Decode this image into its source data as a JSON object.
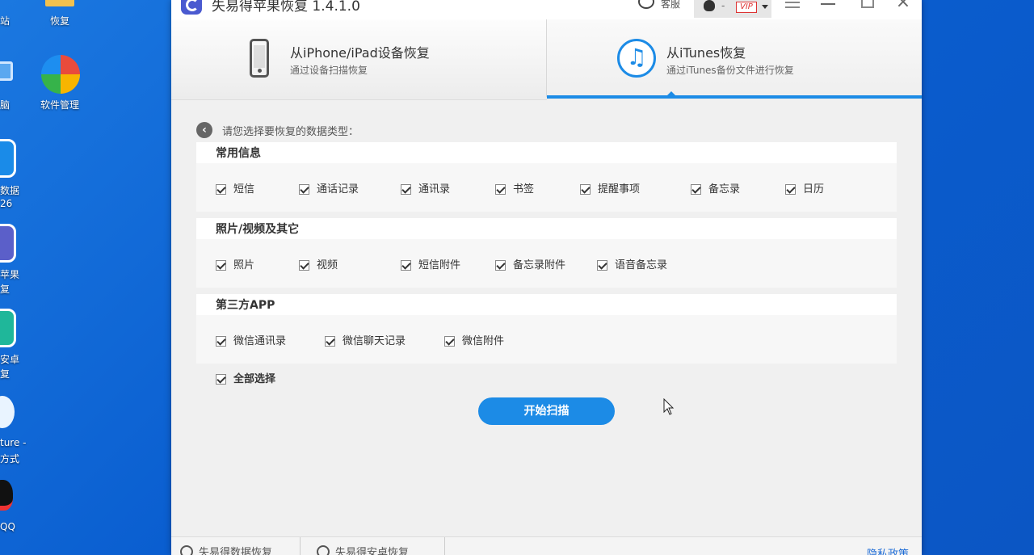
{
  "desktop": {
    "icons": [
      {
        "name": "desktop-icon-recovery-folder",
        "label": "恢复"
      },
      {
        "name": "desktop-icon-software-manager",
        "label": "软件管理"
      }
    ],
    "clipped_labels": [
      "站",
      "脑",
      "数据",
      "26",
      "苹果",
      "复",
      "安卓",
      "复",
      "ture -",
      "方式",
      "QQ"
    ]
  },
  "window": {
    "title": "失易得苹果恢复 1.4.1.0",
    "customer_service": "客服",
    "user_dash": "-",
    "vip_badge": "VIP"
  },
  "tabs": [
    {
      "title": "从iPhone/iPad设备恢复",
      "subtitle": "通过设备扫描恢复",
      "icon": "phone-icon",
      "active": false
    },
    {
      "title": "从iTunes恢复",
      "subtitle": "通过iTunes备份文件进行恢复",
      "icon": "itunes-icon",
      "active": true
    }
  ],
  "content": {
    "prompt": "请您选择要恢复的数据类型：",
    "sections": [
      {
        "title": "常用信息",
        "items": [
          {
            "label": "短信",
            "checked": true
          },
          {
            "label": "通话记录",
            "checked": true
          },
          {
            "label": "通讯录",
            "checked": true
          },
          {
            "label": "书签",
            "checked": true
          },
          {
            "label": "提醒事项",
            "checked": true
          },
          {
            "label": "备忘录",
            "checked": true
          },
          {
            "label": "日历",
            "checked": true
          }
        ]
      },
      {
        "title": "照片/视频及其它",
        "items": [
          {
            "label": "照片",
            "checked": true
          },
          {
            "label": "视频",
            "checked": true
          },
          {
            "label": "短信附件",
            "checked": true
          },
          {
            "label": "备忘录附件",
            "checked": true
          },
          {
            "label": "语音备忘录",
            "checked": true
          }
        ]
      },
      {
        "title": "第三方APP",
        "items": [
          {
            "label": "微信通讯录",
            "checked": true
          },
          {
            "label": "微信聊天记录",
            "checked": true
          },
          {
            "label": "微信附件",
            "checked": true
          }
        ]
      }
    ],
    "select_all": {
      "label": "全部选择",
      "checked": true
    },
    "scan_button": "开始扫描"
  },
  "footer": {
    "links": [
      "失易得数据恢复",
      "失易得安卓恢复"
    ],
    "privacy": "隐私政策"
  },
  "colors": {
    "accent": "#1c8be6",
    "desktop": "#0b5fd0",
    "vip": "#d33333"
  }
}
